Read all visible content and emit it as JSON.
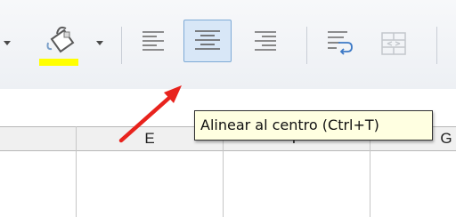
{
  "toolbar": {
    "buttons": [
      {
        "name": "fill-color",
        "icon": "paint-bucket-icon",
        "color": "#ffff00"
      },
      {
        "name": "align-left",
        "icon": "align-left-icon"
      },
      {
        "name": "align-center",
        "icon": "align-center-icon",
        "active": true
      },
      {
        "name": "align-right",
        "icon": "align-right-icon"
      },
      {
        "name": "wrap-text",
        "icon": "wrap-text-icon"
      },
      {
        "name": "merge-cells",
        "icon": "merge-cells-icon",
        "disabled": true
      }
    ]
  },
  "tooltip": {
    "text": "Alinear al centro (Ctrl+T)"
  },
  "sheet": {
    "columns": [
      "E",
      "F",
      "G"
    ]
  },
  "annotation": {
    "arrow_color": "#e8231d"
  }
}
